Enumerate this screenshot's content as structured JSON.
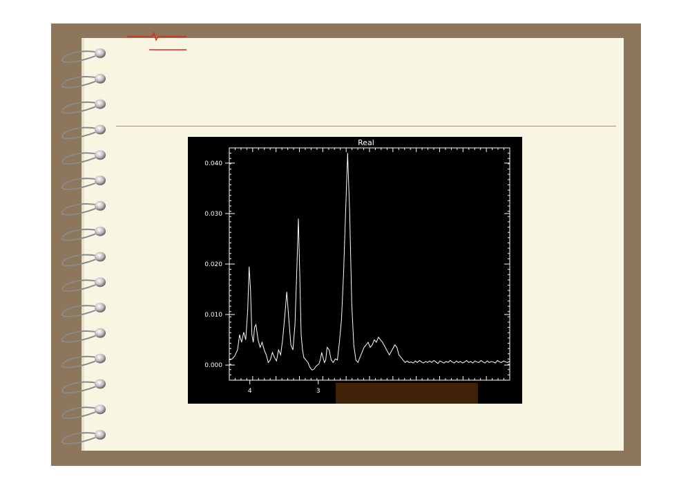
{
  "chart_data": {
    "type": "line",
    "title": "Real",
    "xlabel": "",
    "ylabel": "",
    "x_reversed": true,
    "xlim": [
      4.3,
      0.2
    ],
    "ylim": [
      -0.003,
      0.043
    ],
    "y_ticks": [
      0.0,
      0.01,
      0.02,
      0.03,
      0.04
    ],
    "y_tick_labels": [
      "0.000",
      "0.010",
      "0.020",
      "0.030",
      "0.040"
    ],
    "x_ticks": [
      4,
      3
    ],
    "x_tick_labels": [
      "4",
      "3"
    ],
    "grid": false,
    "series": [
      {
        "color": "#ffffff",
        "x": [
          4.3,
          4.26,
          4.22,
          4.18,
          4.15,
          4.12,
          4.09,
          4.06,
          4.03,
          4.01,
          3.99,
          3.97,
          3.95,
          3.93,
          3.91,
          3.88,
          3.85,
          3.82,
          3.79,
          3.76,
          3.73,
          3.7,
          3.67,
          3.64,
          3.61,
          3.58,
          3.55,
          3.52,
          3.49,
          3.46,
          3.43,
          3.4,
          3.37,
          3.34,
          3.31,
          3.29,
          3.27,
          3.25,
          3.23,
          3.21,
          3.18,
          3.15,
          3.12,
          3.09,
          3.06,
          3.03,
          3.01,
          2.99,
          2.97,
          2.95,
          2.93,
          2.91,
          2.89,
          2.87,
          2.84,
          2.81,
          2.78,
          2.75,
          2.72,
          2.69,
          2.66,
          2.63,
          2.6,
          2.57,
          2.54,
          2.51,
          2.48,
          2.45,
          2.42,
          2.39,
          2.36,
          2.33,
          2.3,
          2.27,
          2.24,
          2.21,
          2.18,
          2.15,
          2.12,
          2.09,
          2.06,
          2.04,
          2.02,
          2.0,
          1.98,
          1.96,
          1.94,
          1.92,
          1.9,
          1.88,
          1.85,
          1.82,
          1.79,
          1.76,
          1.73,
          1.7,
          1.67,
          1.64,
          1.61,
          1.58,
          1.55,
          1.52,
          1.49,
          1.46,
          1.43,
          1.4,
          1.37,
          1.34,
          1.31,
          1.28,
          1.25,
          1.22,
          1.19,
          1.16,
          1.13,
          1.1,
          1.07,
          1.04,
          1.01,
          0.98,
          0.95,
          0.92,
          0.89,
          0.86,
          0.83,
          0.8,
          0.77,
          0.74,
          0.71,
          0.68,
          0.65,
          0.62,
          0.59,
          0.56,
          0.53,
          0.5,
          0.47,
          0.44,
          0.41,
          0.38,
          0.35,
          0.32,
          0.29,
          0.26,
          0.23,
          0.2
        ],
        "y": [
          0.001,
          0.0012,
          0.0018,
          0.003,
          0.006,
          0.0045,
          0.0065,
          0.005,
          0.011,
          0.0195,
          0.015,
          0.006,
          0.0045,
          0.0075,
          0.008,
          0.005,
          0.0035,
          0.0045,
          0.003,
          0.002,
          0.0005,
          0.001,
          0.0025,
          0.0015,
          0.0008,
          0.003,
          0.002,
          0.005,
          0.0095,
          0.0145,
          0.009,
          0.004,
          0.003,
          0.008,
          0.02,
          0.029,
          0.018,
          0.006,
          0.003,
          0.0015,
          0.001,
          0.0005,
          -0.0005,
          -0.001,
          -0.0008,
          -0.0002,
          0.0,
          0.0002,
          0.001,
          0.0025,
          0.0015,
          0.0005,
          0.001,
          0.0035,
          0.003,
          0.001,
          0.0005,
          0.0012,
          0.001,
          0.0045,
          0.009,
          0.018,
          0.03,
          0.042,
          0.03,
          0.012,
          0.004,
          0.001,
          0.0005,
          0.0015,
          0.0025,
          0.0035,
          0.004,
          0.0045,
          0.0035,
          0.004,
          0.005,
          0.0045,
          0.0055,
          0.005,
          0.0045,
          0.004,
          0.0035,
          0.003,
          0.0025,
          0.002,
          0.0025,
          0.003,
          0.0035,
          0.004,
          0.0035,
          0.002,
          0.0015,
          0.001,
          0.0005,
          0.0008,
          0.0005,
          0.0006,
          0.0004,
          0.0008,
          0.0005,
          0.0009,
          0.0006,
          0.0004,
          0.0007,
          0.0005,
          0.0008,
          0.0005,
          0.0009,
          0.0006,
          0.0003,
          0.0008,
          0.0006,
          0.0004,
          0.0007,
          0.0005,
          0.0009,
          0.0006,
          0.0004,
          0.0008,
          0.0005,
          0.0007,
          0.0004,
          0.0006,
          0.0009,
          0.0005,
          0.0007,
          0.0004,
          0.0008,
          0.0006,
          0.0005,
          0.0009,
          0.0006,
          0.0004,
          0.0008,
          0.0005,
          0.0007,
          0.0006,
          0.0004,
          0.0009,
          0.0006,
          0.0005,
          0.0008,
          0.0006,
          0.0005,
          0.0008
        ]
      }
    ]
  },
  "colors": {
    "frame": "#8c765c",
    "page": "#f8f6e2",
    "rule": "#a7907a",
    "logo": "#e0241c",
    "plot_background": "#000000",
    "plot_foreground": "#ffffff",
    "overlay_bar": "#3f2208"
  },
  "icons": {
    "logo": "ecg-pulse-logo",
    "binding": "spiral-binding-rings"
  }
}
